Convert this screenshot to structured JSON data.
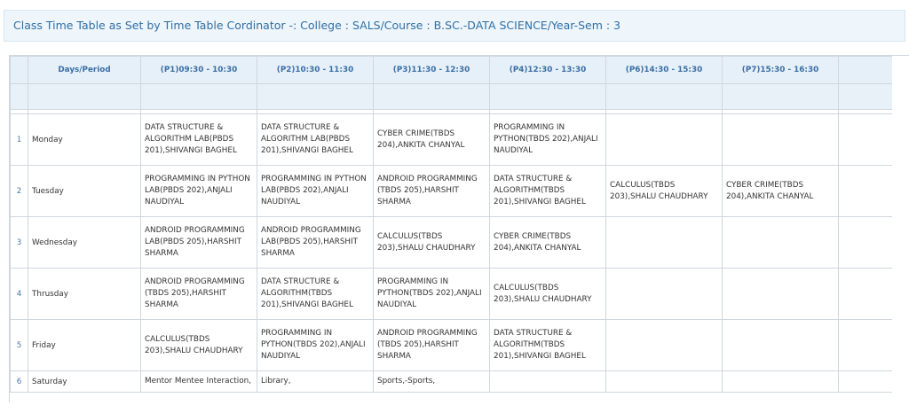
{
  "header": {
    "title": "Class Time Table as Set by Time Table Cordinator -: College : SALS/Course : B.SC.-DATA SCIENCE/Year-Sem : 3"
  },
  "table": {
    "columns": [
      "",
      "Days/Period",
      "(P1)09:30 - 10:30",
      "(P2)10:30 - 11:30",
      "(P3)11:30 - 12:30",
      "(P4)12:30 - 13:30",
      "(P6)14:30 - 15:30",
      "(P7)15:30 - 16:30"
    ],
    "rows": [
      {
        "num": "1",
        "day": "Monday",
        "cells": [
          "DATA STRUCTURE & ALGORITHM LAB(PBDS 201),SHIVANGI BAGHEL",
          "DATA STRUCTURE & ALGORITHM LAB(PBDS 201),SHIVANGI BAGHEL",
          "CYBER CRIME(TBDS 204),ANKITA CHANYAL",
          "PROGRAMMING IN PYTHON(TBDS 202),ANJALI NAUDIYAL",
          "",
          ""
        ]
      },
      {
        "num": "2",
        "day": "Tuesday",
        "cells": [
          "PROGRAMMING IN PYTHON LAB(PBDS 202),ANJALI NAUDIYAL",
          "PROGRAMMING IN PYTHON LAB(PBDS 202),ANJALI NAUDIYAL",
          "ANDROID PROGRAMMING (TBDS 205),HARSHIT SHARMA",
          "DATA STRUCTURE & ALGORITHM(TBDS 201),SHIVANGI BAGHEL",
          "CALCULUS(TBDS 203),SHALU CHAUDHARY",
          "CYBER CRIME(TBDS 204),ANKITA CHANYAL"
        ]
      },
      {
        "num": "3",
        "day": "Wednesday",
        "cells": [
          "ANDROID PROGRAMMING LAB(PBDS 205),HARSHIT SHARMA",
          "ANDROID PROGRAMMING LAB(PBDS 205),HARSHIT SHARMA",
          "CALCULUS(TBDS 203),SHALU CHAUDHARY",
          "CYBER CRIME(TBDS 204),ANKITA CHANYAL",
          "",
          ""
        ]
      },
      {
        "num": "4",
        "day": "Thrusday",
        "cells": [
          "ANDROID PROGRAMMING (TBDS 205),HARSHIT SHARMA",
          "DATA STRUCTURE & ALGORITHM(TBDS 201),SHIVANGI BAGHEL",
          "PROGRAMMING IN PYTHON(TBDS 202),ANJALI NAUDIYAL",
          "CALCULUS(TBDS 203),SHALU CHAUDHARY",
          "",
          ""
        ]
      },
      {
        "num": "5",
        "day": "Friday",
        "cells": [
          "CALCULUS(TBDS 203),SHALU CHAUDHARY",
          "PROGRAMMING IN PYTHON(TBDS 202),ANJALI NAUDIYAL",
          "ANDROID PROGRAMMING (TBDS 205),HARSHIT SHARMA",
          "DATA STRUCTURE & ALGORITHM(TBDS 201),SHIVANGI BAGHEL",
          "",
          ""
        ]
      },
      {
        "num": "6",
        "day": "Saturday",
        "cells": [
          "Mentor Mentee Interaction,",
          "Library,",
          "Sports,-Sports,",
          "",
          "",
          ""
        ]
      }
    ]
  }
}
